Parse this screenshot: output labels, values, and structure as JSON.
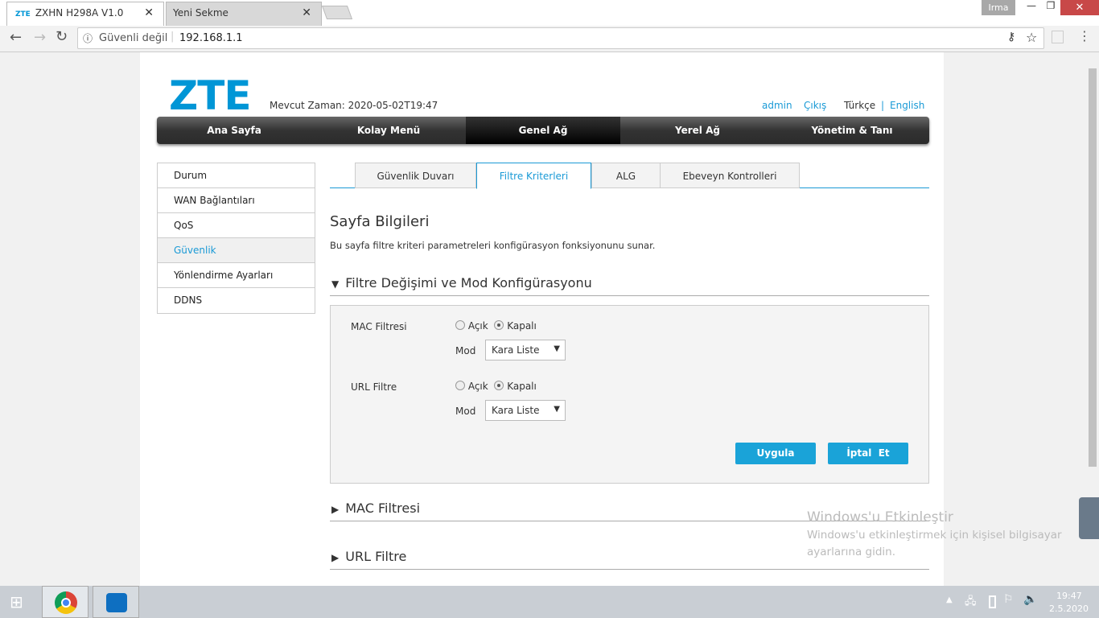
{
  "browser": {
    "tabs": [
      {
        "favicon": "ZTE",
        "title": "ZXHN H298A V1.0"
      },
      {
        "title": "Yeni Sekme"
      }
    ],
    "user": "Irma",
    "security": "Güvenli değil",
    "url": "192.168.1.1"
  },
  "header": {
    "logo": "ZTE",
    "time_label": "Mevcut Zaman: 2020-05-02T19:47",
    "links": {
      "admin": "admin",
      "logout": "Çıkış",
      "lang_tr": "Türkçe",
      "sep": "|",
      "lang_en": "English"
    }
  },
  "nav": [
    "Ana Sayfa",
    "Kolay Menü",
    "Genel Ağ",
    "Yerel Ağ",
    "Yönetim & Tanı"
  ],
  "sidebar": [
    "Durum",
    "WAN Bağlantıları",
    "QoS",
    "Güvenlik",
    "Yönlendirme Ayarları",
    "DDNS"
  ],
  "tabs": [
    "Güvenlik Duvarı",
    "Filtre Kriterleri",
    "ALG",
    "Ebeveyn Kontrolleri"
  ],
  "main": {
    "title": "Sayfa Bilgileri",
    "desc": "Bu sayfa filtre kriteri parametreleri konfigürasyon fonksiyonunu sunar.",
    "section1": "Filtre Değişimi ve Mod Konfigürasyonu",
    "mac": {
      "label": "MAC Filtresi",
      "on": "Açık",
      "off": "Kapalı",
      "mod": "Mod",
      "value": "Kara Liste"
    },
    "url": {
      "label": "URL Filtre",
      "on": "Açık",
      "off": "Kapalı",
      "mod": "Mod",
      "value": "Kara Liste"
    },
    "apply": "Uygula",
    "cancel": "İptal  Et",
    "section2": "MAC Filtresi",
    "section3": "URL Filtre"
  },
  "watermark": {
    "title": "Windows'u Etkinleştir",
    "line1": "Windows'u etkinleştirmek için kişisel bilgisayar",
    "line2": "ayarlarına gidin."
  },
  "taskbar": {
    "time": "19:47",
    "date": "2.5.2020"
  }
}
